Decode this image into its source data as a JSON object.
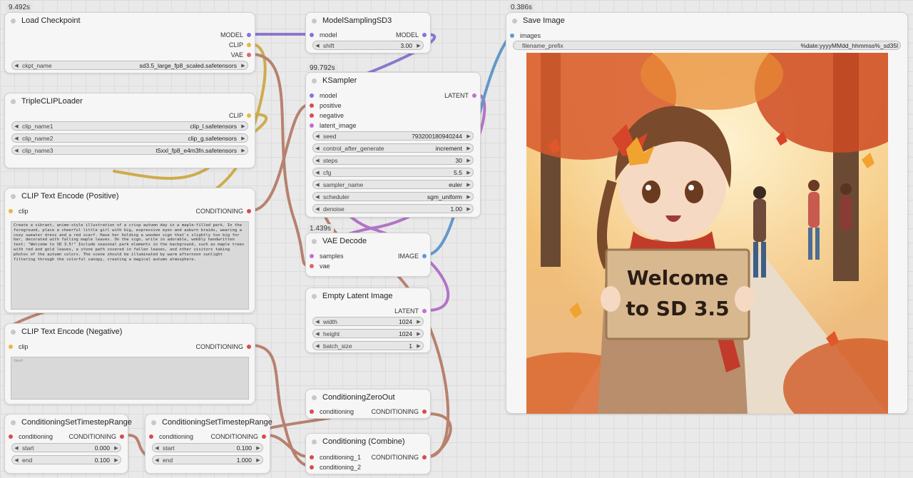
{
  "nodes": {
    "load_checkpoint": {
      "time": "9.492s",
      "title": "Load Checkpoint",
      "out_model": "MODEL",
      "out_clip": "CLIP",
      "out_vae": "VAE",
      "ckpt_label": "ckpt_name",
      "ckpt_value": "sd3.5_large_fp8_scaled.safetensors"
    },
    "triple_clip": {
      "title": "TripleCLIPLoader",
      "out_clip": "CLIP",
      "widgets": [
        {
          "label": "clip_name1",
          "value": "clip_l.safetensors"
        },
        {
          "label": "clip_name2",
          "value": "clip_g.safetensors"
        },
        {
          "label": "clip_name3",
          "value": "t5xxl_fp8_e4m3fn.safetensors"
        }
      ]
    },
    "clip_pos": {
      "title": "CLIP Text Encode (Positive)",
      "in_clip": "clip",
      "out": "CONDITIONING",
      "text": "Create a vibrant, anime-style illustration of a crisp autumn day in a maple-filled park. In the foreground, place a cheerful little girl with big, expressive eyes and auburn braids, wearing a cozy sweater dress and a red scarf. Have her holding a wooden sign that's slightly too big for her, decorated with falling maple leaves. On the sign, write in adorable, wobbly handwritten text: \"Welcome to SD 3.5!\" Include seasonal park elements in the background, such as maple trees with red and gold leaves, a stone path covered in fallen leaves, and other visitors taking photos of the autumn colors. The scene should be illuminated by warm afternoon sunlight filtering through the colorful canopy, creating a magical autumn atmosphere."
    },
    "clip_neg": {
      "title": "CLIP Text Encode (Negative)",
      "in_clip": "clip",
      "out": "CONDITIONING",
      "placeholder": "text"
    },
    "cond_range1": {
      "title": "ConditioningSetTimestepRange",
      "in": "conditioning",
      "out": "CONDITIONING",
      "start_label": "start",
      "start": "0.000",
      "end_label": "end",
      "end": "0.100"
    },
    "cond_range2": {
      "title": "ConditioningSetTimestepRange",
      "in": "conditioning",
      "out": "CONDITIONING",
      "start_label": "start",
      "start": "0.100",
      "end_label": "end",
      "end": "1.000"
    },
    "model_sampling": {
      "title": "ModelSamplingSD3",
      "in": "model",
      "out": "MODEL",
      "shift_label": "shift",
      "shift": "3.00"
    },
    "ksampler": {
      "time": "99.792s",
      "title": "KSampler",
      "inputs": [
        "model",
        "positive",
        "negative",
        "latent_image"
      ],
      "out": "LATENT",
      "widgets": [
        {
          "label": "seed",
          "value": "793200180940244"
        },
        {
          "label": "control_after_generate",
          "value": "increment"
        },
        {
          "label": "steps",
          "value": "30"
        },
        {
          "label": "cfg",
          "value": "5.5"
        },
        {
          "label": "sampler_name",
          "value": "euler"
        },
        {
          "label": "scheduler",
          "value": "sgm_uniform"
        },
        {
          "label": "denoise",
          "value": "1.00"
        }
      ]
    },
    "vae_decode": {
      "time": "1.439s",
      "title": "VAE Decode",
      "in_samples": "samples",
      "in_vae": "vae",
      "out": "IMAGE"
    },
    "empty_latent": {
      "title": "Empty Latent Image",
      "out": "LATENT",
      "widgets": [
        {
          "label": "width",
          "value": "1024"
        },
        {
          "label": "height",
          "value": "1024"
        },
        {
          "label": "batch_size",
          "value": "1"
        }
      ]
    },
    "cond_zero": {
      "title": "ConditioningZeroOut",
      "in": "conditioning",
      "out": "CONDITIONING"
    },
    "cond_combine": {
      "title": "Conditioning (Combine)",
      "in1": "conditioning_1",
      "in2": "conditioning_2",
      "out": "CONDITIONING"
    },
    "save_image": {
      "time": "0.386s",
      "title": "Save Image",
      "in": "images",
      "prefix_label": "filename_prefix",
      "prefix_value": "%date:yyyyMMdd_hhmmss%_sd35l",
      "sign_line1": "Welcome",
      "sign_line2": "to SD 3.5"
    }
  },
  "colors": {
    "model": "#8b6fe0",
    "clip": "#e6b93c",
    "vae": "#e0646b",
    "conditioning": "#e8a07a",
    "latent": "#c070d0",
    "image": "#5b9ad8"
  }
}
